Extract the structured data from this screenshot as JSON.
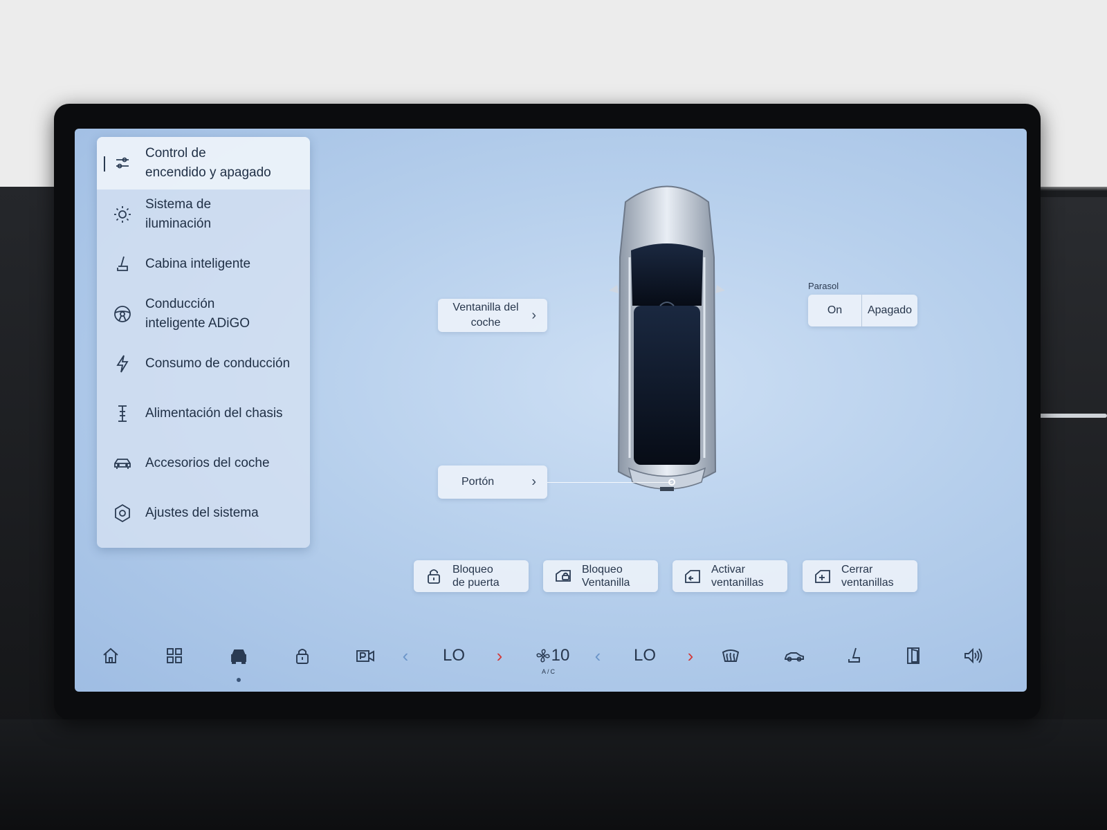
{
  "menu": {
    "items": [
      {
        "label": "Control de\nencendido y apagado",
        "icon": "sliders-icon",
        "active": true
      },
      {
        "label": "Sistema de\niluminación",
        "icon": "sun-icon"
      },
      {
        "label": "Cabina inteligente",
        "icon": "seat-icon"
      },
      {
        "label": "Conducción\ninteligente ADiGO",
        "icon": "steering-wheel-icon"
      },
      {
        "label": "Consumo de conducción",
        "icon": "lightning-icon"
      },
      {
        "label": "Alimentación del chasis",
        "icon": "chassis-icon"
      },
      {
        "label": "Accesorios del coche",
        "icon": "car-icon"
      },
      {
        "label": "Ajustes del sistema",
        "icon": "settings-hexagon-icon"
      }
    ]
  },
  "controls": {
    "window_label": "Ventanilla del\ncoche",
    "gate_label": "Portón",
    "chevron": "›",
    "parasol": {
      "title": "Parasol",
      "on": "On",
      "off": "Apagado"
    }
  },
  "actions": [
    {
      "label": "Bloqueo\nde puerta",
      "icon": "padlock-icon"
    },
    {
      "label": "Bloqueo\nVentanilla",
      "icon": "window-lock-icon"
    },
    {
      "label": "Activar\nventanillas",
      "icon": "window-open-icon"
    },
    {
      "label": "Cerrar\nventanillas",
      "icon": "window-close-icon"
    }
  ],
  "dock": {
    "temp_left": "LO",
    "fan_speed": "10",
    "ac_label": "A/C",
    "temp_right": "LO",
    "arrow_left": "‹",
    "arrow_right": "›"
  },
  "colors": {
    "screen": "#b6cfec",
    "text": "#27364c",
    "arrow_left": "#6b95c9",
    "arrow_right": "#d23a3a"
  }
}
